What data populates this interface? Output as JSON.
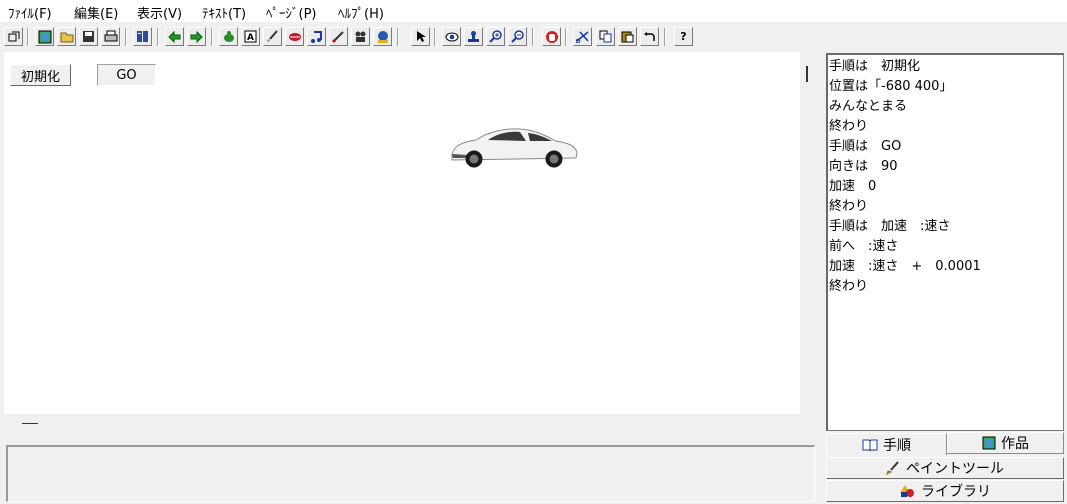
{
  "menu": [
    "ﾌｧｲﾙ(F)",
    "編集(E)",
    "表示(V)",
    "ﾃｷｽﾄ(T)",
    "ﾍﾟｰｼﾞ(P)",
    "ﾍﾙﾌﾟ(H)"
  ],
  "toolbar": {
    "icons": [
      "restore-icon",
      "globe-icon",
      "open-folder-icon",
      "save-icon",
      "print-icon",
      "columns-icon",
      "back-arrow-icon",
      "forward-arrow-icon",
      "turtle-icon",
      "text-box-icon",
      "brush-icon",
      "lips-icon",
      "music-note-icon",
      "pen-icon",
      "movie-camera-icon",
      "network-icon",
      "pointer-icon",
      "eye-icon",
      "stamp-icon",
      "zoom-in-icon",
      "zoom-out-icon",
      "stop-hand-icon",
      "scissors-icon",
      "copy-icon",
      "paste-icon",
      "undo-icon",
      "help-icon"
    ],
    "help_label": "?"
  },
  "canvas": {
    "init_button_label": "初期化",
    "go_field_value": "GO",
    "car_description": "white sedan car sprite"
  },
  "script_lines": [
    "手順は　初期化",
    "位置は「-680 400」",
    "みんなとまる",
    "終わり",
    "手順は　GO",
    "向きは　90",
    "加速　0",
    "終わり",
    "手順は　加速　:速さ",
    "前へ　:速さ",
    "加速　:速さ　+　0.0001",
    "終わり"
  ],
  "tabs": {
    "procedure": "手順",
    "works": "作品"
  },
  "panel_buttons": {
    "paint_tool": "ペイントツール",
    "library": "ライブラリ"
  },
  "colors": {
    "canvas_bg": "#ffffff",
    "window_bg": "#f0f0f0"
  }
}
